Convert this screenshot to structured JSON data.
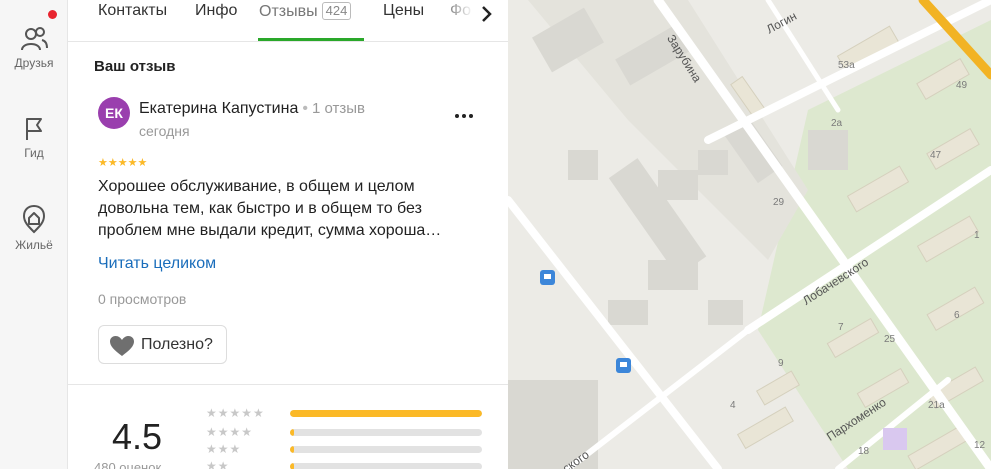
{
  "rail": {
    "items": [
      {
        "label": "Друзья",
        "icon": "friends-icon"
      },
      {
        "label": "Гид",
        "icon": "flag-icon"
      },
      {
        "label": "Жильё",
        "icon": "housing-icon"
      }
    ],
    "notification_color": "#e8242f"
  },
  "tabs": {
    "items": [
      {
        "label": "Контакты"
      },
      {
        "label": "Инфо"
      },
      {
        "label": "Отзывы",
        "count": "424",
        "active": true
      },
      {
        "label": "Цены"
      },
      {
        "label": "Фо"
      }
    ],
    "active_color": "#2aa82a"
  },
  "review": {
    "section_title": "Ваш отзыв",
    "avatar_initials": "ЕК",
    "avatar_color": "#9a3fae",
    "author": "Екатерина Капустина",
    "author_reviews": "1 отзыв",
    "date": "сегодня",
    "stars": "★★★★★",
    "text": "Хорошее обслуживание, в общем и целом довольна тем, как быстро и в общем то без проблем мне выдали кредит, сумма хороша…",
    "read_more": "Читать целиком",
    "views": "0 просмотров",
    "useful_label": "Полезно?"
  },
  "summary": {
    "rating": "4.5",
    "count": "480 оценок",
    "bars": [
      {
        "stars": "★★★★★",
        "fraction": 1.0
      },
      {
        "stars": "★★★★",
        "fraction": 0.02
      },
      {
        "stars": "★★★",
        "fraction": 0.02
      },
      {
        "stars": "★★",
        "fraction": 0.02
      }
    ],
    "accent_color": "#fbb927"
  },
  "map": {
    "streets": [
      "Зарубина",
      "Логин",
      "Лобачевского",
      "Пархоменко",
      "ского"
    ],
    "house_numbers": [
      "53а",
      "49",
      "2а",
      "47",
      "29",
      "1",
      "6",
      "7",
      "25",
      "9",
      "4",
      "21а",
      "18",
      "12"
    ],
    "transit_icon": "bus-stop-icon"
  }
}
